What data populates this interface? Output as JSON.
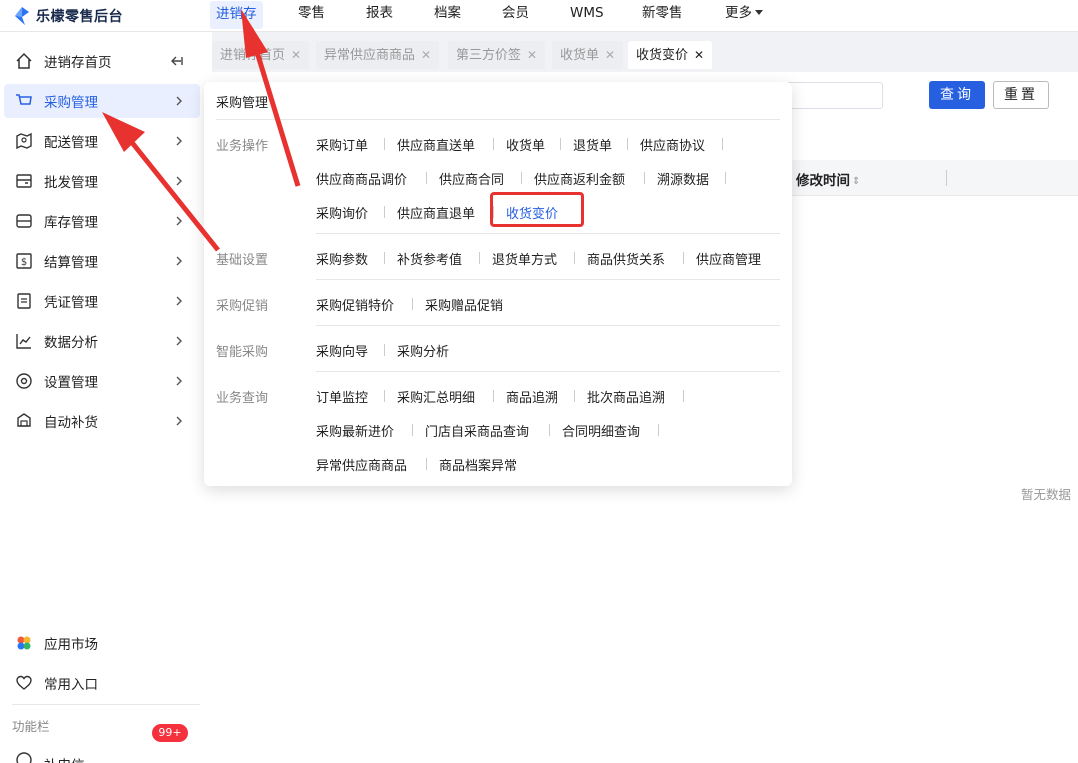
{
  "brand": {
    "name": "乐檬零售后台"
  },
  "topnav": {
    "items": [
      "进销存",
      "零售",
      "报表",
      "档案",
      "会员",
      "WMS",
      "新零售",
      "更多"
    ]
  },
  "sidebar": {
    "items": [
      {
        "label": "进销存首页",
        "icon": "home-icon"
      },
      {
        "label": "采购管理",
        "icon": "cart-icon"
      },
      {
        "label": "配送管理",
        "icon": "map-icon"
      },
      {
        "label": "批发管理",
        "icon": "wallet-icon"
      },
      {
        "label": "库存管理",
        "icon": "box-icon"
      },
      {
        "label": "结算管理",
        "icon": "dollar-icon"
      },
      {
        "label": "凭证管理",
        "icon": "document-icon"
      },
      {
        "label": "数据分析",
        "icon": "chart-icon"
      },
      {
        "label": "设置管理",
        "icon": "settings-icon"
      },
      {
        "label": "自动补货",
        "icon": "truck-icon"
      }
    ],
    "bottom": [
      {
        "label": "应用市场",
        "icon": "app-market-icon"
      },
      {
        "label": "常用入口",
        "icon": "heart-icon"
      }
    ],
    "section_title": "功能栏",
    "partial_item": "补申信",
    "badge": "99+"
  },
  "tabs": [
    "进销存首页",
    "异常供应商商品",
    "第三方价签",
    "收货单",
    "收货变价"
  ],
  "toolbar": {
    "query": "查询",
    "reset": "重置"
  },
  "table": {
    "column_modified": "修改时间",
    "empty": "暂无数据"
  },
  "dropdown": {
    "title": "采购管理",
    "groups": {
      "ops": {
        "label": "业务操作",
        "row1": [
          "采购订单",
          "供应商直送单",
          "收货单",
          "退货单",
          "供应商协议"
        ],
        "row2": [
          "供应商商品调价",
          "供应商合同",
          "供应商返利金额",
          "溯源数据"
        ],
        "row3": [
          "采购询价",
          "供应商直退单",
          "收货变价"
        ]
      },
      "base": {
        "label": "基础设置",
        "items": [
          "采购参数",
          "补货参考值",
          "退货单方式",
          "商品供货关系",
          "供应商管理"
        ]
      },
      "promo": {
        "label": "采购促销",
        "items": [
          "采购促销特价",
          "采购赠品促销"
        ]
      },
      "smart": {
        "label": "智能采购",
        "items": [
          "采购向导",
          "采购分析"
        ]
      },
      "query": {
        "label": "业务查询",
        "row1": [
          "订单监控",
          "采购汇总明细",
          "商品追溯",
          "批次商品追溯"
        ],
        "row2": [
          "采购最新进价",
          "门店自采商品查询",
          "合同明细查询"
        ],
        "row3": [
          "异常供应商商品",
          "商品档案异常"
        ]
      }
    }
  },
  "colors": {
    "accent": "#2660e0",
    "highlight": "#e8322f",
    "badge": "#f5313d"
  }
}
